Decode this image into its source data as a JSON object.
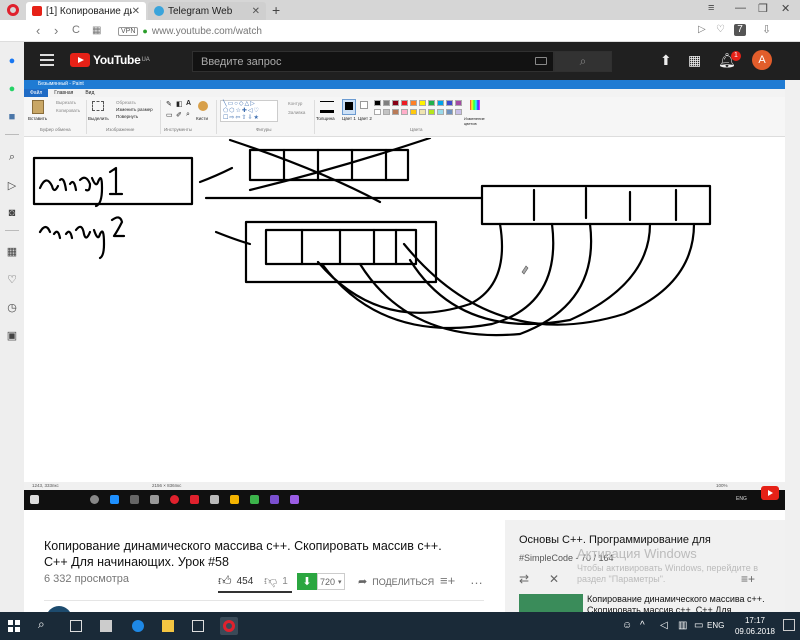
{
  "browser": {
    "tabs": [
      {
        "label": "[1] Копирование динами",
        "active": true
      },
      {
        "label": "Telegram Web",
        "active": false
      }
    ],
    "new_tab": "+",
    "vpn_badge": "VPN",
    "url": "www.youtube.com/watch"
  },
  "youtube": {
    "logo": "YouTube",
    "country": "UA",
    "search_placeholder": "Введите запрос",
    "notification_count": "1",
    "avatar_letter": "A"
  },
  "paint": {
    "title": "Безымянный - Paint",
    "tabs": [
      "Файл",
      "Главная",
      "Вид"
    ],
    "groups": [
      "Буфер обмена",
      "Изображение",
      "Инструменты",
      "Фигуры",
      "Цвета"
    ],
    "tools": {
      "paste": "Вставить",
      "cut": "Вырезать",
      "copy": "Копировать",
      "select": "Выделить",
      "crop": "Обрезать",
      "resize": "Изменить размер",
      "rotate": "Повернуть",
      "brushes": "Кисти",
      "outline": "Контур",
      "fill": "Заливка",
      "thickness": "Толщина",
      "color1": "Цвет 1",
      "color2": "Цвет 2",
      "edit_colors": "Изменение цветов"
    },
    "canvas_labels": [
      "array 1",
      "array2"
    ],
    "status_pos": "1243, 333пкс",
    "status_size": "2156 × 836пкс",
    "zoom": "100%",
    "inner_lang": "ENG",
    "palette": [
      "#000000",
      "#7f7f7f",
      "#880015",
      "#ed1c24",
      "#ff7f27",
      "#fff200",
      "#22b14c",
      "#00a2e8",
      "#3f48cc",
      "#a349a4",
      "#ffffff",
      "#c3c3c3",
      "#b97a57",
      "#ffaec9",
      "#ffc90e",
      "#efe4b0",
      "#b5e61d",
      "#99d9ea",
      "#7092be",
      "#c8bfe7"
    ]
  },
  "video": {
    "title": "Копирование динамического массива c++. Скопировать массив c++. C++ Для начинающих. Урок #58",
    "views": "6 332 просмотра",
    "likes": "454",
    "dislikes": "1",
    "like_ratio": 0.998,
    "subscribers": "720",
    "share": "ПОДЕЛИТЬСЯ",
    "more": "…"
  },
  "playlist": {
    "title": "Основы C++. Программирование для",
    "subtitle": "#SimpleCode - 70 / 164",
    "item": "Копирование динамического массива c++. Скопировать массив c++. C++ Для"
  },
  "activation": {
    "title": "Активация Windows",
    "text": "Чтобы активировать Windows, перейдите в раздел \"Параметры\"."
  },
  "taskbar": {
    "lang": "ENG",
    "time": "17:17",
    "date": "09.06.2018"
  },
  "colors": {
    "yt_red": "#e62117",
    "subscribe_green": "#2ba640",
    "yt_header": "#202020",
    "paint_blue": "#1f7bd3"
  }
}
